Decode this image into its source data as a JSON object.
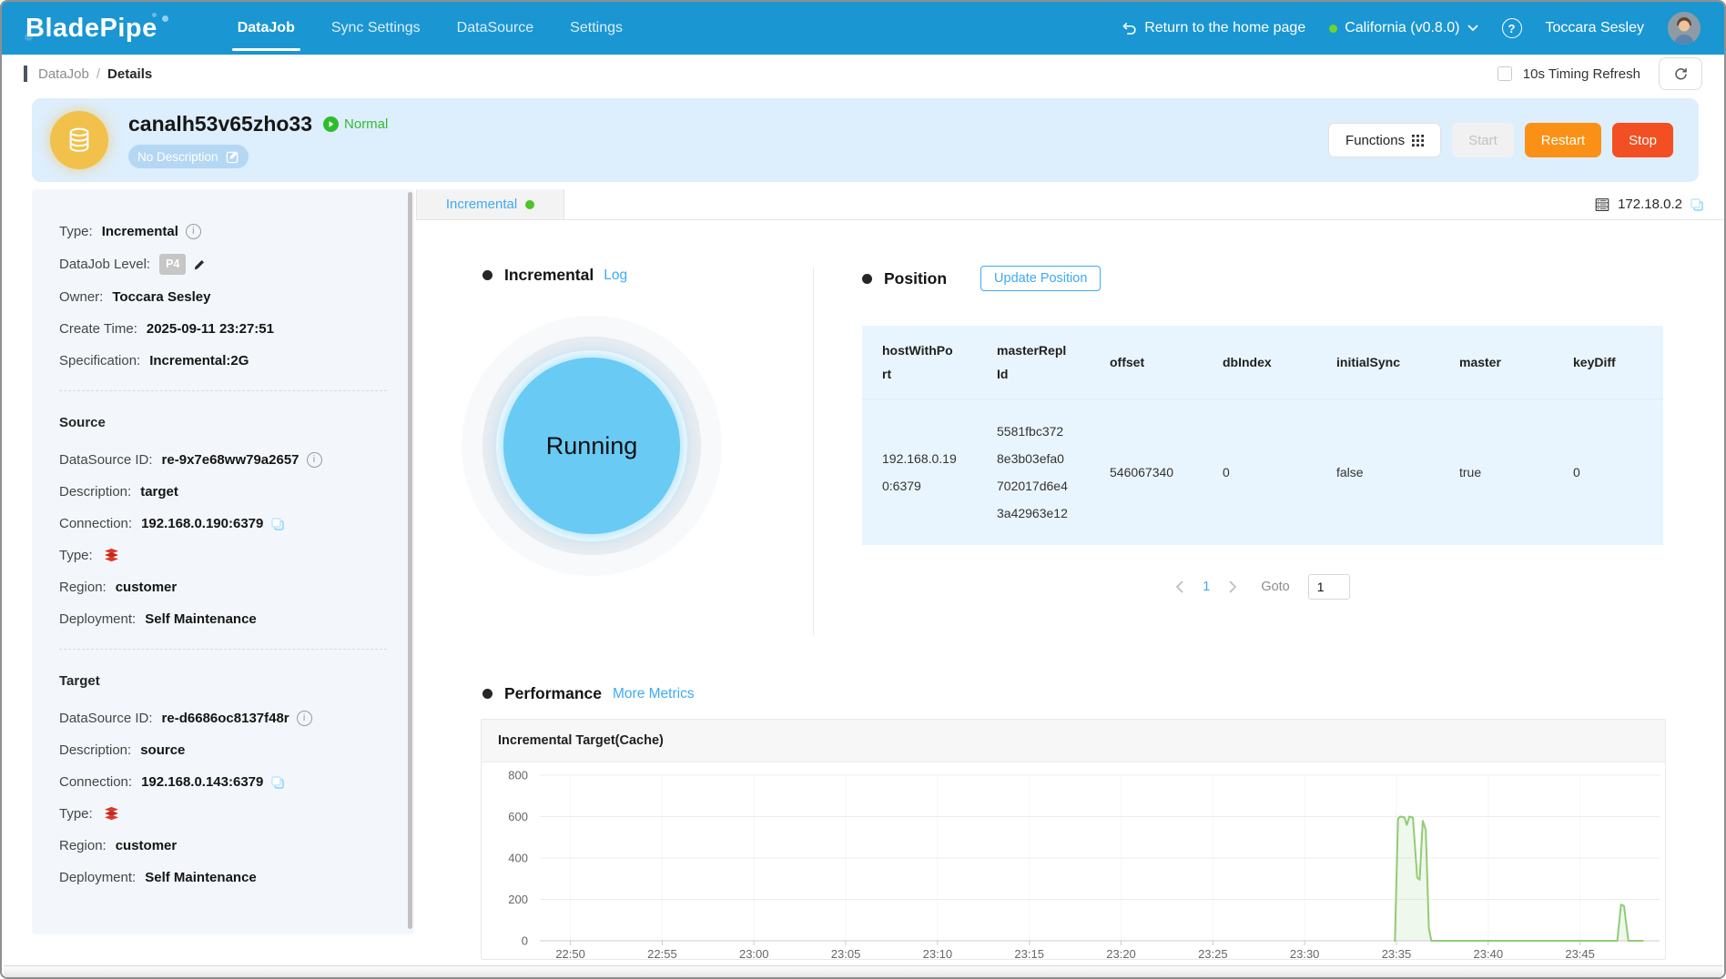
{
  "colors": {
    "navbar_blue": "#1a96d3",
    "link_blue": "#3daaf5",
    "status_green": "#2fbd2f",
    "restart_orange": "#fa9116",
    "stop_red": "#f25022",
    "job_icon_yellow": "#f2c14b",
    "running_blue": "#69caf4",
    "chart_green": "#91cc75",
    "table_bg": "#e9f5fe"
  },
  "navbar": {
    "logo": "BladePipe",
    "items": [
      {
        "label": "DataJob",
        "active": true
      },
      {
        "label": "Sync Settings",
        "active": false
      },
      {
        "label": "DataSource",
        "active": false
      },
      {
        "label": "Settings",
        "active": false
      }
    ],
    "return_home": "Return to the home page",
    "region": "California (v0.8.0)",
    "user": "Toccara Sesley"
  },
  "breadcrumb": {
    "section": "DataJob",
    "separator": "/",
    "page": "Details",
    "timing_refresh": "10s Timing Refresh"
  },
  "job": {
    "name": "canalh53v65zho33",
    "status": "Normal",
    "description": "No Description",
    "buttons": {
      "functions": "Functions",
      "start": "Start",
      "restart": "Restart",
      "stop": "Stop"
    }
  },
  "sidebar": {
    "general": [
      {
        "label": "Type:",
        "value": "Incremental"
      },
      {
        "label": "DataJob Level:",
        "value": "P4"
      },
      {
        "label": "Owner:",
        "value": "Toccara Sesley"
      },
      {
        "label": "Create Time:",
        "value": "2025-09-11 23:27:51"
      },
      {
        "label": "Specification:",
        "value": "Incremental:2G"
      }
    ],
    "source": {
      "heading": "Source",
      "rows": [
        {
          "label": "DataSource ID:",
          "value": "re-9x7e68ww79a2657"
        },
        {
          "label": "Description:",
          "value": "target"
        },
        {
          "label": "Connection:",
          "value": "192.168.0.190:6379"
        },
        {
          "label": "Type:",
          "value": ""
        },
        {
          "label": "Region:",
          "value": "customer"
        },
        {
          "label": "Deployment:",
          "value": "Self Maintenance"
        }
      ]
    },
    "target": {
      "heading": "Target",
      "rows": [
        {
          "label": "DataSource ID:",
          "value": "re-d6686oc8137f48r"
        },
        {
          "label": "Description:",
          "value": "source"
        },
        {
          "label": "Connection:",
          "value": "192.168.0.143:6379"
        },
        {
          "label": "Type:",
          "value": ""
        },
        {
          "label": "Region:",
          "value": "customer"
        },
        {
          "label": "Deployment:",
          "value": "Self Maintenance"
        }
      ]
    }
  },
  "tabs": {
    "incremental": "Incremental"
  },
  "host": {
    "ip": "172.18.0.2"
  },
  "incremental_section": {
    "heading": "Incremental",
    "log_link": "Log",
    "state": "Running"
  },
  "position_section": {
    "heading": "Position",
    "update_button": "Update Position",
    "table": {
      "headers": [
        "hostWithPort",
        "masterReplId",
        "offset",
        "dbIndex",
        "initialSync",
        "master",
        "keyDiff"
      ],
      "rows": [
        [
          "192.168.0.190:6379",
          "5581fbc3728e3b03efa0702017d6e43a42963e12",
          "546067340",
          "0",
          "false",
          "true",
          "0"
        ]
      ]
    },
    "pagination": {
      "page": "1",
      "goto_label": "Goto",
      "goto_value": "1"
    }
  },
  "performance_section": {
    "heading": "Performance",
    "metrics_link": "More Metrics"
  },
  "chart_data": {
    "type": "line",
    "title": "Incremental Target(Cache)",
    "xlabel": "",
    "ylabel": "",
    "ylim": [
      0,
      800
    ],
    "y_ticks": [
      0,
      200,
      400,
      600,
      800
    ],
    "x_ticks": [
      "22:50",
      "22:55",
      "23:00",
      "23:05",
      "23:10",
      "23:15",
      "23:20",
      "23:25",
      "23:30",
      "23:35",
      "23:40",
      "23:45"
    ],
    "x_range": [
      "22:48:20",
      "23:49:20"
    ],
    "grid": true,
    "legend_position": "none",
    "series": [
      {
        "name": "Incremental Target(Cache)",
        "color": "#91cc75",
        "points": [
          [
            "23:34:55",
            0
          ],
          [
            "23:35:05",
            588
          ],
          [
            "23:35:12",
            600
          ],
          [
            "23:35:26",
            597
          ],
          [
            "23:35:34",
            560
          ],
          [
            "23:35:42",
            600
          ],
          [
            "23:35:54",
            595
          ],
          [
            "23:36:08",
            305
          ],
          [
            "23:36:16",
            295
          ],
          [
            "23:36:26",
            580
          ],
          [
            "23:36:36",
            535
          ],
          [
            "23:36:46",
            60
          ],
          [
            "23:36:54",
            0
          ],
          [
            "23:40:00",
            0
          ],
          [
            "23:44:00",
            0
          ],
          [
            "23:47:02",
            0
          ],
          [
            "23:47:14",
            175
          ],
          [
            "23:47:24",
            168
          ],
          [
            "23:47:38",
            0
          ],
          [
            "23:48:25",
            0
          ]
        ]
      }
    ]
  }
}
